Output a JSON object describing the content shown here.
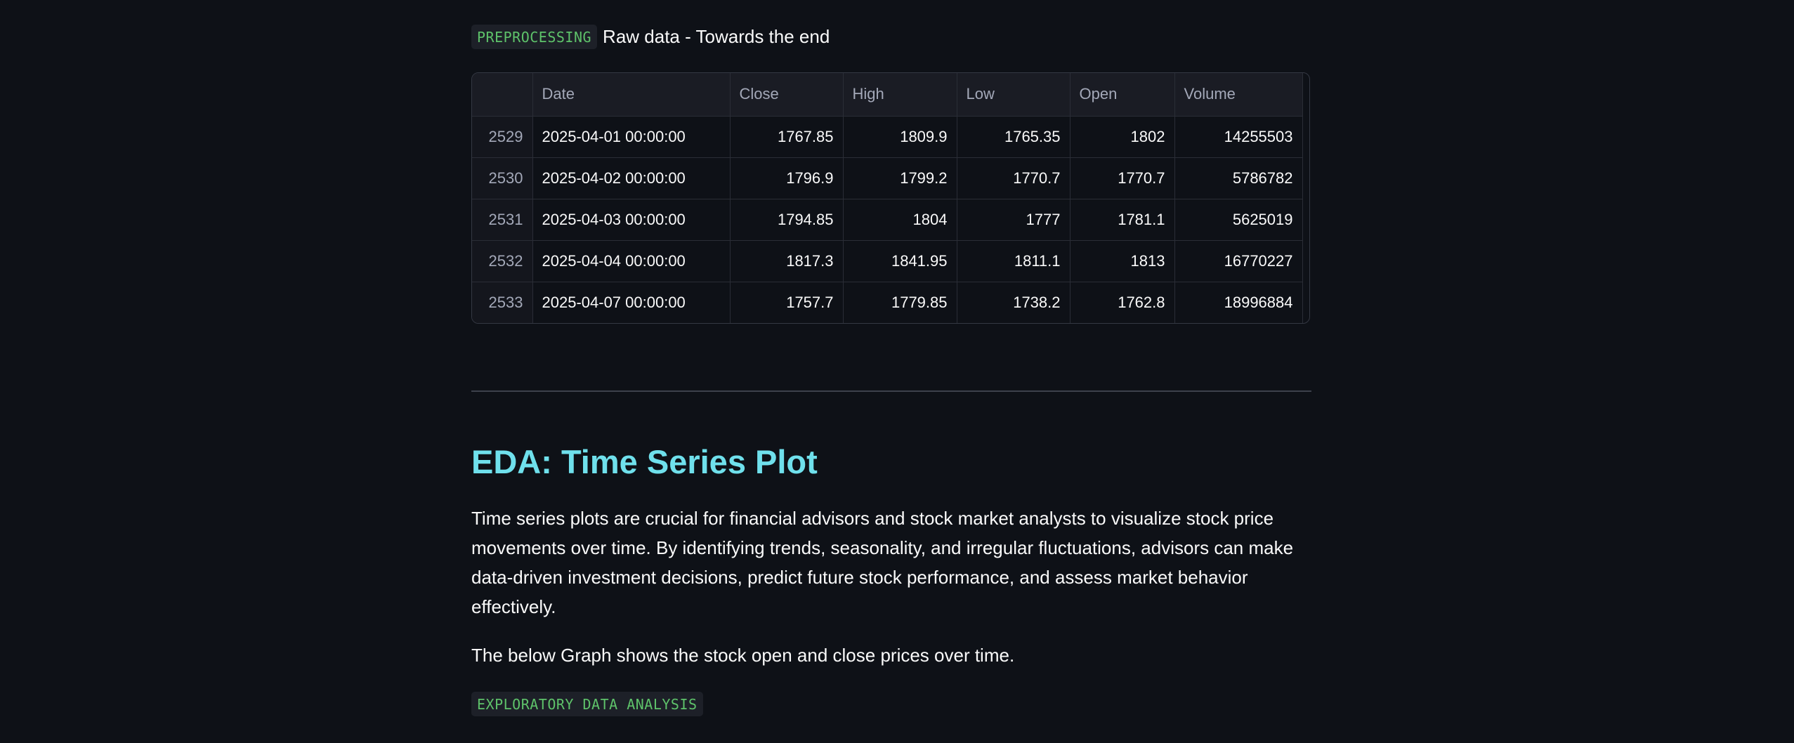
{
  "preprocessing": {
    "badge": "PREPROCESSING",
    "title": "Raw data - Towards the end"
  },
  "table": {
    "columns": [
      "",
      "Date",
      "Close",
      "High",
      "Low",
      "Open",
      "Volume"
    ],
    "rows": [
      {
        "index": "2529",
        "date": "2025-04-01 00:00:00",
        "close": "1767.85",
        "high": "1809.9",
        "low": "1765.35",
        "open": "1802",
        "volume": "14255503"
      },
      {
        "index": "2530",
        "date": "2025-04-02 00:00:00",
        "close": "1796.9",
        "high": "1799.2",
        "low": "1770.7",
        "open": "1770.7",
        "volume": "5786782"
      },
      {
        "index": "2531",
        "date": "2025-04-03 00:00:00",
        "close": "1794.85",
        "high": "1804",
        "low": "1777",
        "open": "1781.1",
        "volume": "5625019"
      },
      {
        "index": "2532",
        "date": "2025-04-04 00:00:00",
        "close": "1817.3",
        "high": "1841.95",
        "low": "1811.1",
        "open": "1813",
        "volume": "16770227"
      },
      {
        "index": "2533",
        "date": "2025-04-07 00:00:00",
        "close": "1757.7",
        "high": "1779.85",
        "low": "1738.2",
        "open": "1762.8",
        "volume": "18996884"
      }
    ]
  },
  "eda": {
    "heading": "EDA: Time Series Plot",
    "paragraph1": "Time series plots are crucial for financial advisors and stock market analysts to visualize stock price movements over time. By identifying trends, seasonality, and irregular fluctuations, advisors can make data-driven investment decisions, predict future stock performance, and assess market behavior effectively.",
    "paragraph2": "The below Graph shows the stock open and close prices over time.",
    "badge": "EXPLORATORY DATA ANALYSIS"
  },
  "colors": {
    "background": "#0e1117",
    "heading": "#6fe0ec",
    "badge_text": "#5ec26a"
  }
}
